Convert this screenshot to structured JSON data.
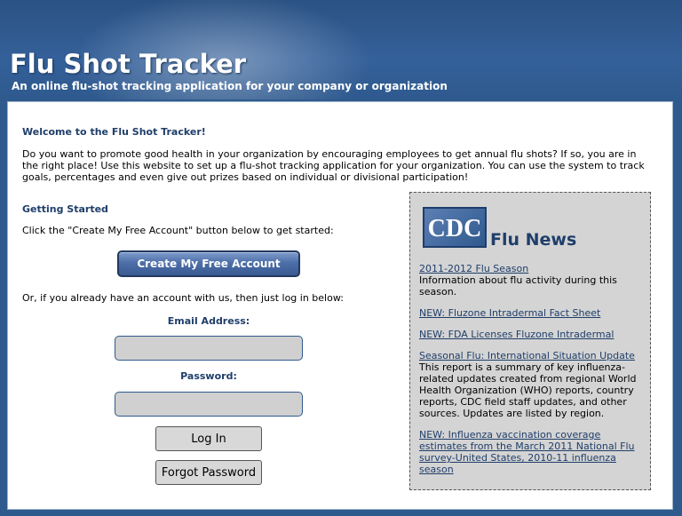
{
  "header": {
    "title": "Flu Shot Tracker",
    "subtitle": "An online flu-shot tracking application for your company or organization"
  },
  "welcome": {
    "title": "Welcome to the Flu Shot Tracker!",
    "intro": "Do you want to promote good health in your organization by encouraging employees to get annual flu shots? If so, you are in the right place! Use this website to set up a flu-shot tracking application for your organization. You can use the system to track goals, percentages and even give out prizes based on individual or divisional participation!"
  },
  "getting_started": {
    "title": "Getting Started",
    "instructions": "Click the \"Create My Free Account\" button below to get started:",
    "create_button": "Create My Free Account",
    "login_prompt": "Or, if you already have an account with us, then just log in below:"
  },
  "login": {
    "email_label": "Email Address:",
    "email_value": "",
    "password_label": "Password:",
    "password_value": "",
    "login_button": "Log In",
    "forgot_button": "Forgot Password"
  },
  "news": {
    "logo_text": "CDC",
    "title": "Flu News",
    "items": [
      {
        "link": "2011-2012 Flu Season",
        "desc": "Information about flu activity during this season."
      },
      {
        "link": "NEW: Fluzone Intradermal Fact Sheet",
        "desc": ""
      },
      {
        "link": "NEW: FDA Licenses Fluzone Intradermal",
        "desc": ""
      },
      {
        "link": "Seasonal Flu: International Situation Update",
        "desc": "This report is a summary of key influenza-related updates created from regional World Health Organization (WHO) reports, country reports, CDC field staff updates, and other sources. Updates are listed by region."
      },
      {
        "link": "NEW: Influenza vaccination coverage estimates from the March 2011 National Flu survey-United States, 2010-11 influenza season",
        "desc": ""
      }
    ]
  },
  "colors": {
    "header_bg": "#2f5a8e",
    "heading": "#1f3e6a",
    "news_bg": "#d4d4d4"
  }
}
